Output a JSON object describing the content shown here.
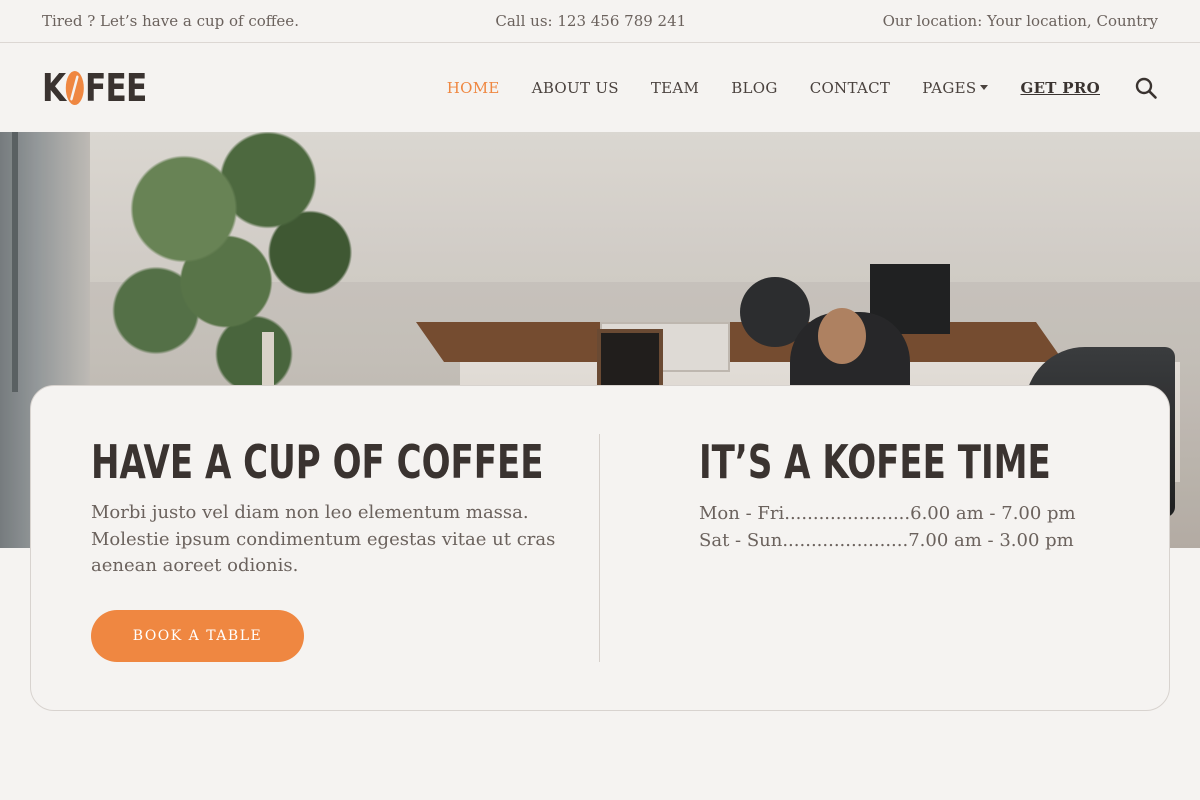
{
  "topbar": {
    "tagline": "Tired ? Let’s have a cup of coffee.",
    "phone": "Call us: 123 456 789 241",
    "location": "Our location: Your location, Country"
  },
  "logo": {
    "prefix": "K",
    "suffix": "FEE",
    "icon": "coffee-bean-icon"
  },
  "nav": {
    "items": [
      {
        "label": "HOME",
        "active": true
      },
      {
        "label": "ABOUT US"
      },
      {
        "label": "TEAM"
      },
      {
        "label": "BLOG"
      },
      {
        "label": "CONTACT"
      },
      {
        "label": "PAGES"
      },
      {
        "label": "GET PRO"
      }
    ],
    "search_icon": "search-icon"
  },
  "card": {
    "left": {
      "heading": "HAVE A CUP OF COFFEE",
      "text": "Morbi justo vel diam non leo elementum massa. Molestie ipsum condimentum egestas vitae ut cras aenean aoreet odionis.",
      "button": "BOOK A TABLE"
    },
    "right": {
      "heading": "IT’S A KOFEE TIME",
      "hours": [
        "Mon - Fri......................6.00 am - 7.00 pm",
        "Sat - Sun......................7.00 am - 3.00 pm"
      ]
    }
  },
  "colors": {
    "accent": "#ef8741",
    "text_dark": "#3a3330",
    "text_muted": "#6b625d",
    "background": "#f5f3f1"
  }
}
